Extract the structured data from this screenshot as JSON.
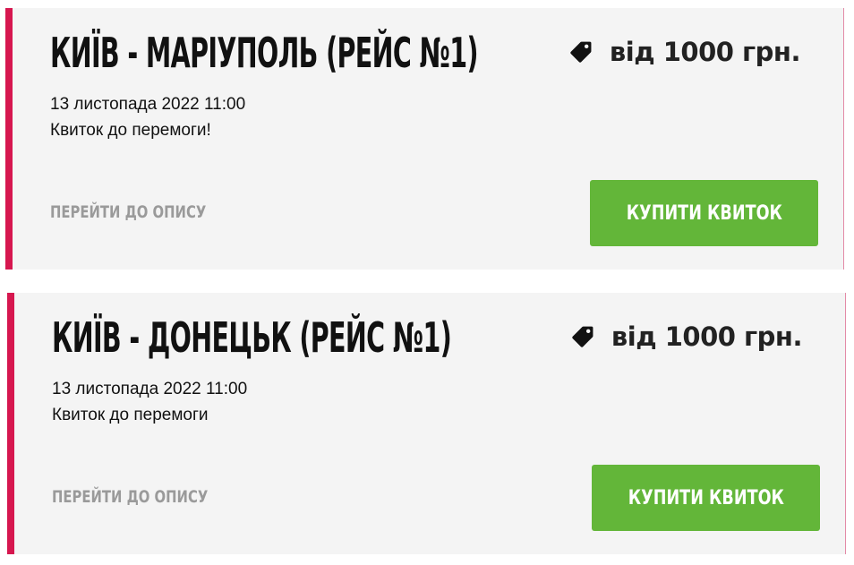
{
  "colors": {
    "accent_bar": "#d6174f",
    "card_background": "#f4f4f4",
    "buy_button": "#63b639",
    "link_text": "#9a9a9a"
  },
  "trips": [
    {
      "title": "КИЇВ - МАРІУПОЛЬ (РЕЙС №1)",
      "price": "від 1000 грн.",
      "price_icon": "price-tag-icon",
      "datetime": "13 листопада 2022 11:00",
      "note": "Квиток до перемоги!",
      "details_link": "ПЕРЕЙТИ ДО ОПИСУ",
      "buy_label": "КУПИТИ КВИТОК"
    },
    {
      "title": "КИЇВ - ДОНЕЦЬК (РЕЙС №1)",
      "price": "від 1000 грн.",
      "price_icon": "price-tag-icon",
      "datetime": "13 листопада 2022 11:00",
      "note": "Квиток до перемоги",
      "details_link": "ПЕРЕЙТИ ДО ОПИСУ",
      "buy_label": "КУПИТИ КВИТОК"
    }
  ]
}
